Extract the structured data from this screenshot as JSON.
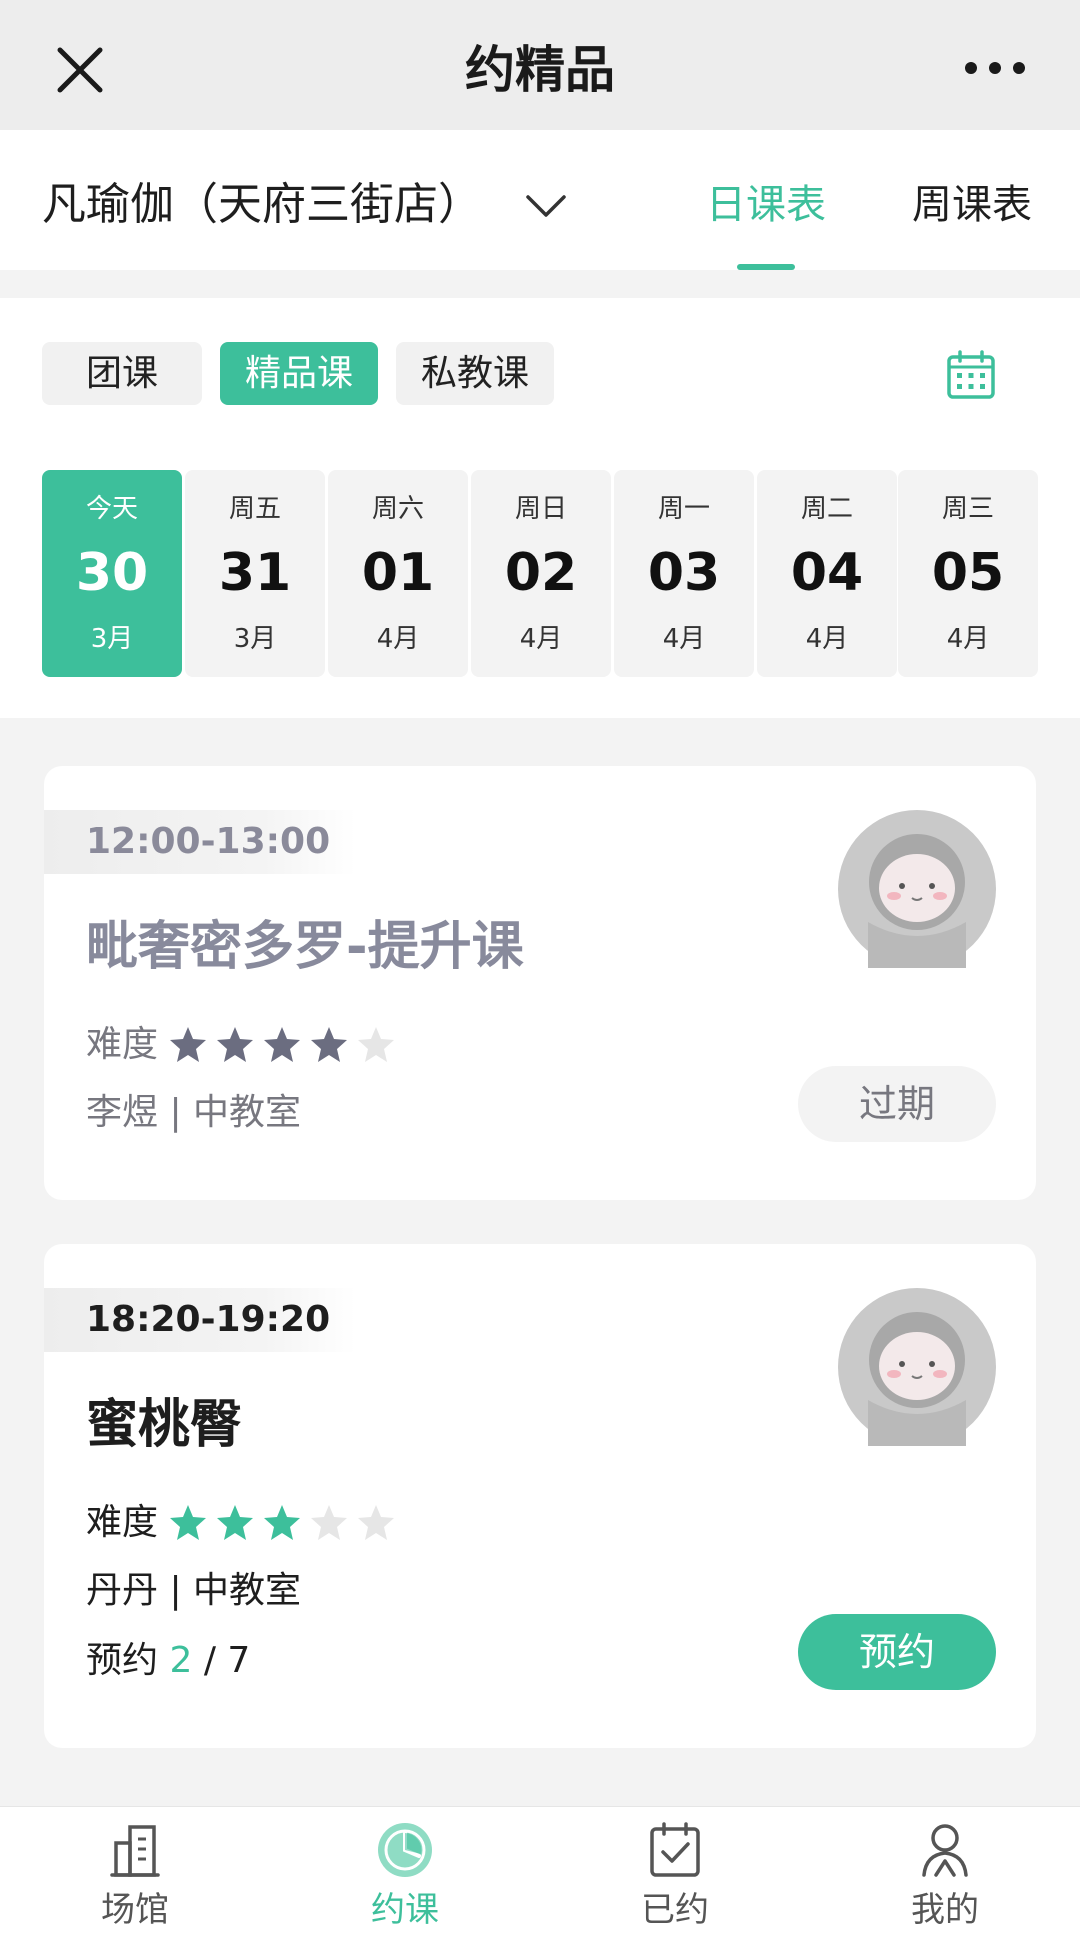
{
  "titlebar": {
    "title": "约精品",
    "close_icon": "close-icon",
    "more_icon": "more-icon"
  },
  "store": {
    "name": "凡瑜伽（天府三街店）",
    "dropdown_icon": "chevron-down-icon"
  },
  "view_tabs": {
    "day": "日课表",
    "week": "周课表",
    "active": "day"
  },
  "course_types": [
    {
      "label": "团课",
      "active": false
    },
    {
      "label": "精品课",
      "active": true
    },
    {
      "label": "私教课",
      "active": false
    }
  ],
  "calendar_icon": "calendar-icon",
  "dates": [
    {
      "weekday": "今天",
      "day": "30",
      "month": "3月",
      "active": true
    },
    {
      "weekday": "周五",
      "day": "31",
      "month": "3月",
      "active": false
    },
    {
      "weekday": "周六",
      "day": "01",
      "month": "4月",
      "active": false
    },
    {
      "weekday": "周日",
      "day": "02",
      "month": "4月",
      "active": false
    },
    {
      "weekday": "周一",
      "day": "03",
      "month": "4月",
      "active": false
    },
    {
      "weekday": "周二",
      "day": "04",
      "month": "4月",
      "active": false
    },
    {
      "weekday": "周三",
      "day": "05",
      "month": "4月",
      "active": false
    }
  ],
  "classes": [
    {
      "time": "12:00-13:00",
      "name": "毗奢密多罗-提升课",
      "difficulty_label": "难度",
      "difficulty": 4,
      "difficulty_max": 5,
      "teacher_room": "李煜 | 中教室",
      "action": "过期",
      "status": "expired"
    },
    {
      "time": "18:20-19:20",
      "name": "蜜桃臀",
      "difficulty_label": "难度",
      "difficulty": 3,
      "difficulty_max": 5,
      "teacher_room": "丹丹 | 中教室",
      "booking_label": "预约",
      "booked": "2",
      "sep": "/",
      "capacity": "7",
      "action": "预约",
      "status": "open"
    }
  ],
  "bottom_nav": [
    {
      "label": "场馆",
      "icon": "building-icon",
      "active": false
    },
    {
      "label": "约课",
      "icon": "clock-icon",
      "active": true
    },
    {
      "label": "已约",
      "icon": "calendar-check-icon",
      "active": false
    },
    {
      "label": "我的",
      "icon": "user-icon",
      "active": false
    }
  ],
  "colors": {
    "accent": "#3dbf9b",
    "expired_text": "#888a9c",
    "star_off": "#e6e6e6",
    "star_expired": "#6b6d80"
  }
}
